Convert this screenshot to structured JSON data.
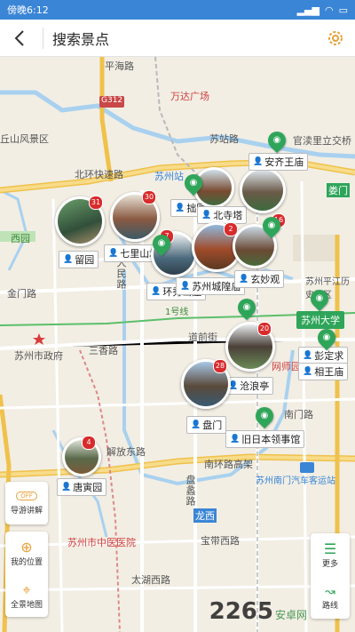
{
  "status_bar": {
    "time": "傍晚6:12",
    "icons": [
      "signal-icon",
      "wifi-icon",
      "battery-icon"
    ]
  },
  "header": {
    "title": "搜索景点",
    "back_icon": "back-arrow-icon",
    "settings_icon": "gear-icon"
  },
  "map_labels": [
    {
      "name": "road-pinghai",
      "text": "平海路"
    },
    {
      "name": "place-wanda",
      "text": "万达广场"
    },
    {
      "name": "place-qiuhuafeng",
      "text": "丘山风景区"
    },
    {
      "name": "road-g312",
      "text": "G312"
    },
    {
      "name": "road-suzhan",
      "text": "苏站路"
    },
    {
      "name": "place-guanxuli",
      "text": "官渎里立交桥"
    },
    {
      "name": "place-suzhou-station",
      "text": "苏州站"
    },
    {
      "name": "road-beihuan",
      "text": "北环快速路"
    },
    {
      "name": "place-loumen",
      "text": "娄门"
    },
    {
      "name": "place-xiyuan",
      "text": "西园"
    },
    {
      "name": "road-jinmen",
      "text": "金门路"
    },
    {
      "name": "road-renmin",
      "text": "人民路"
    },
    {
      "name": "road-sanxiang",
      "text": "三香路"
    },
    {
      "name": "place-gov",
      "text": "苏州市政府"
    },
    {
      "name": "road-daoqian",
      "text": "道前街"
    },
    {
      "name": "place-wangshi",
      "text": "网师园"
    },
    {
      "name": "road-nanmen",
      "text": "南门路"
    },
    {
      "name": "road-jiefang",
      "text": "解放东路"
    },
    {
      "name": "road-nanhuan",
      "text": "南环路高架"
    },
    {
      "name": "place-southbus",
      "text": "苏州南门汽车客运站"
    },
    {
      "name": "place-longxi",
      "text": "龙西"
    },
    {
      "name": "place-tcm",
      "text": "苏州市中医医院"
    },
    {
      "name": "road-baosheng",
      "text": "宝带西路"
    },
    {
      "name": "road-taihu",
      "text": "太湖西路"
    },
    {
      "name": "road-pan",
      "text": "盘蠡路"
    },
    {
      "name": "road-1hao",
      "text": "1号线"
    },
    {
      "name": "place-pingjiang",
      "text": "苏州平江历史街区"
    }
  ],
  "pois": [
    {
      "name": "liuyuan",
      "label": "留园",
      "badge": "31"
    },
    {
      "name": "qilishantang",
      "label": "七里山塘",
      "badge": "30"
    },
    {
      "name": "zhuo",
      "label": "拙园",
      "badge": ""
    },
    {
      "name": "beisita",
      "label": "北寺塔",
      "badge": ""
    },
    {
      "name": "anqiwangmiao",
      "label": "安齐王庙",
      "badge": ""
    },
    {
      "name": "huanxiu",
      "label": "环秀山庄",
      "badge": "7"
    },
    {
      "name": "chenghuangmiao",
      "label": "苏州城隍庙",
      "badge": "2"
    },
    {
      "name": "xuanmiaoguan",
      "label": "玄妙观",
      "badge": "16"
    },
    {
      "name": "suzhou-univ",
      "label": "苏州大学",
      "badge": ""
    },
    {
      "name": "pengdingqiu",
      "label": "彭定求",
      "badge": ""
    },
    {
      "name": "xiangwangmiao",
      "label": "相王庙",
      "badge": ""
    },
    {
      "name": "canglangting",
      "label": "沧浪亭",
      "badge": "20"
    },
    {
      "name": "panmen",
      "label": "盘门",
      "badge": "28"
    },
    {
      "name": "japan-consulate",
      "label": "旧日本领事馆",
      "badge": ""
    },
    {
      "name": "tangyinyuan",
      "label": "唐寅园",
      "badge": "4"
    }
  ],
  "left_panel": [
    {
      "name": "guide-toggle",
      "label": "导游讲解",
      "icon": "toggle-icon",
      "value": "OFF"
    },
    {
      "name": "my-location",
      "label": "我的位置",
      "icon": "crosshair-icon"
    },
    {
      "name": "full-map",
      "label": "全景地图",
      "icon": "map-pin-icon"
    }
  ],
  "right_panel": [
    {
      "name": "more",
      "label": "更多",
      "icon": "menu-icon"
    },
    {
      "name": "route",
      "label": "路线",
      "icon": "route-icon"
    }
  ],
  "watermark": {
    "text": "2265",
    "sub": "安卓网"
  },
  "colors": {
    "status_bar": "#3a85d6",
    "accent": "#e8a13a",
    "poi_green": "#2fa55a",
    "badge_red": "#d82b2b",
    "road_yellow": "#f5d26a",
    "water": "#a9d1ef"
  }
}
